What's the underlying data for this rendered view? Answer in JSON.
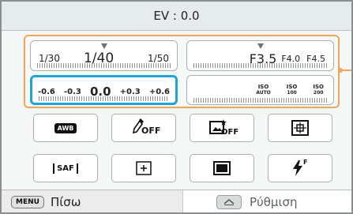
{
  "title": "EV : 0.0",
  "shutter": {
    "left": "1/30",
    "center": "1/40",
    "right": "1/50"
  },
  "aperture": {
    "center": "F3.5",
    "right1": "F4.0",
    "right2": "F4.5"
  },
  "ev": {
    "v1": "-0.6",
    "v2": "-0.3",
    "v3": "0.0",
    "v4": "+0.3",
    "v5": "+0.6"
  },
  "iso": {
    "i1": "ISO",
    "i1n": "AUTO",
    "i2": "ISO",
    "i2n": "100",
    "i3": "ISO",
    "i3n": "200"
  },
  "row1": {
    "wb_text": "AWB",
    "flash_off_text": "OFF",
    "face_off_text": "OFF"
  },
  "row2": {
    "af_text": "SAF",
    "flash_text": "F"
  },
  "bottom": {
    "menu_key": "MENU",
    "back_label": "Πίσω",
    "set_label": "Ρύθμιση"
  },
  "colors": {
    "accent_orange": "#f0a55b",
    "selected_blue": "#1ea3dd",
    "frame_gray": "#8a8f92"
  }
}
